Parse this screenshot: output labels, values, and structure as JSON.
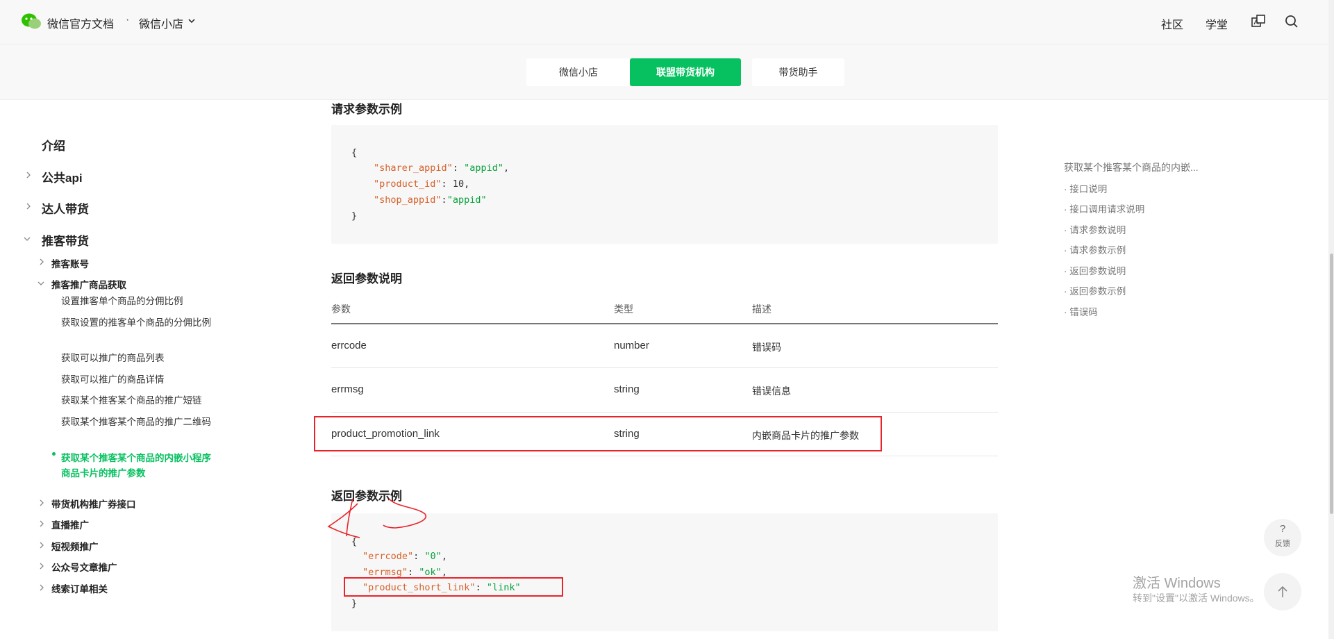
{
  "header": {
    "brand": "微信官方文档",
    "separator": "·",
    "product": "微信小店",
    "nav": [
      "社区",
      "学堂"
    ],
    "icons": [
      "wechat-logo-icon",
      "chevron-down-icon",
      "translate-icon",
      "search-icon"
    ]
  },
  "tabs": [
    {
      "label": "微信小店",
      "active": false
    },
    {
      "label": "联盟带货机构",
      "active": true
    },
    {
      "label": "带货助手",
      "active": false
    }
  ],
  "sidebar": {
    "intro": "介绍",
    "public_api": "公共api",
    "talent": "达人带货",
    "sharer": "推客带货",
    "sharer_account": "推客账号",
    "sharer_products": "推客推广商品获取",
    "sub_items": [
      "设置推客单个商品的分佣比例",
      "获取设置的推客单个商品的分佣比例",
      "获取可以推广的商品列表",
      "获取可以推广的商品详情",
      "获取某个推客某个商品的推广短链",
      "获取某个推客某个商品的推广二维码",
      "获取某个推客某个商品的内嵌小程序商品卡片的推广参数"
    ],
    "more": [
      "带货机构推广券接口",
      "直播推广",
      "短视频推广",
      "公众号文章推广",
      "线索订单相关"
    ]
  },
  "main": {
    "request_example_title": "请求参数示例",
    "request_code": {
      "open": "{",
      "k1": "\"sharer_appid\"",
      "v1": "\"appid\"",
      "k2": "\"product_id\"",
      "v2": "10",
      "k3": "\"shop_appid\"",
      "v3": "\"appid\"",
      "close": "}"
    },
    "return_desc_title": "返回参数说明",
    "table": {
      "headers": [
        "参数",
        "类型",
        "描述"
      ],
      "rows": [
        [
          "errcode",
          "number",
          "错误码"
        ],
        [
          "errmsg",
          "string",
          "错误信息"
        ],
        [
          "product_promotion_link",
          "string",
          "内嵌商品卡片的推广参数"
        ]
      ]
    },
    "return_example_title": "返回参数示例",
    "return_code": {
      "open": "{",
      "k1": "\"errcode\"",
      "v1": "\"0\"",
      "k2": "\"errmsg\"",
      "v2": "\"ok\"",
      "k3": "\"product_short_link\"",
      "v3": "\"link\"",
      "close": "}"
    }
  },
  "toc": {
    "title": "获取某个推客某个商品的内嵌...",
    "items": [
      "· 接口说明",
      "· 接口调用请求说明",
      "· 请求参数说明",
      "· 请求参数示例",
      "· 返回参数说明",
      "· 返回参数示例",
      "· 错误码"
    ]
  },
  "fab": {
    "question": "?",
    "feedback": "反馈",
    "up_icon": "arrow-up-icon"
  },
  "watermark": {
    "line1": "激活 Windows",
    "line2": "转到\"设置\"以激活 Windows。"
  },
  "colors": {
    "accent": "#07c160",
    "annotation": "#e8242b",
    "code_key": "#d6602a",
    "code_string": "#07a13c"
  }
}
